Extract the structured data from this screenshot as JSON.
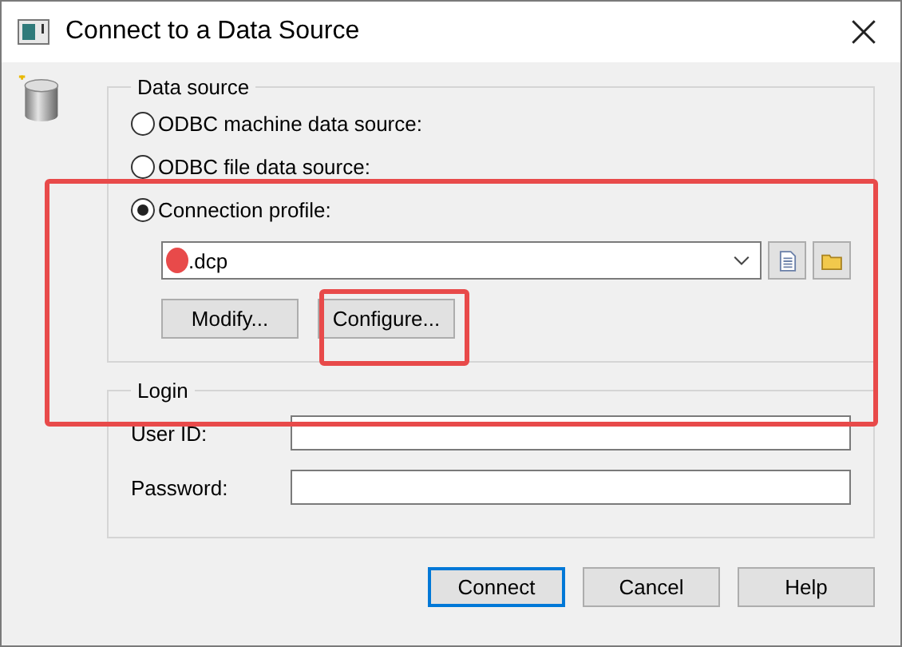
{
  "window": {
    "title": "Connect to a Data Source"
  },
  "data_source": {
    "title": "Data source",
    "options": [
      {
        "label": "ODBC machine data source:",
        "selected": false
      },
      {
        "label": "ODBC file data source:",
        "selected": false
      },
      {
        "label": "Connection profile:",
        "selected": true
      }
    ],
    "profile": {
      "value": ".dcp"
    },
    "buttons": [
      "Modify...",
      "Configure..."
    ]
  },
  "login": {
    "title": "Login",
    "fields": [
      {
        "label": "User ID:"
      },
      {
        "label": "Password:"
      }
    ]
  },
  "buttons": [
    {
      "label": "Connect",
      "default": true
    },
    {
      "label": "Cancel",
      "default": false
    },
    {
      "label": "Help",
      "default": false
    }
  ]
}
